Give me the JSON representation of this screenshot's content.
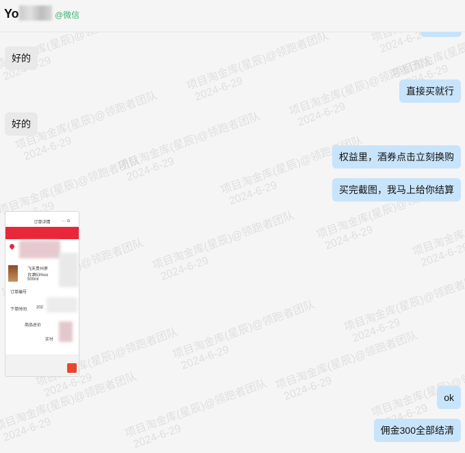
{
  "header": {
    "contact_name": "Yo",
    "wechat_tag": "@微信"
  },
  "messages": [
    {
      "side": "left",
      "text": "好的"
    },
    {
      "side": "right",
      "text": "直接买就行"
    },
    {
      "side": "left",
      "text": "好的"
    },
    {
      "side": "right",
      "text": "权益里，酒券点击立刻换购"
    },
    {
      "side": "right",
      "text": "买完截图，我马上给你结算"
    },
    {
      "side": "right",
      "text": "ok"
    },
    {
      "side": "right",
      "text": "佣金300全部结清"
    }
  ],
  "screenshot": {
    "title": "订单详情",
    "product_line1": "飞天贵州茅",
    "product_line2": "台酒53%vo",
    "product_line3": "500ml",
    "order_no_label": "订单编号",
    "order_time_label": "下单时间",
    "order_time_value": "202",
    "goods_total_label": "商品总价",
    "paid_label": "实付"
  },
  "watermark": {
    "line1": "项目淘金库(星辰)@领跑者团队",
    "line2": "2024-6-29"
  }
}
